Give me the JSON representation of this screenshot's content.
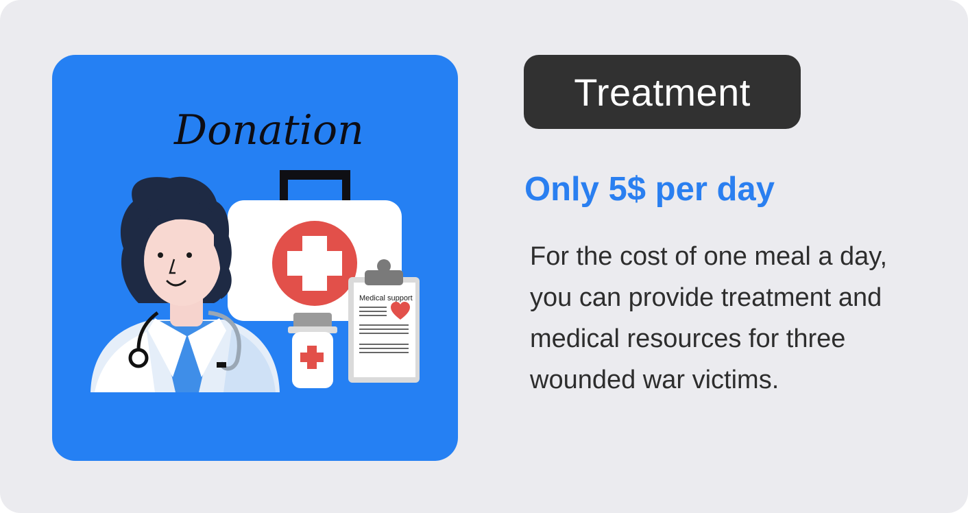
{
  "illustration": {
    "title": "Donation",
    "clipboard_title": "Medical support",
    "icons": [
      "doctor-icon",
      "first-aid-kit-icon",
      "medicine-bottle-icon",
      "clipboard-icon",
      "heart-icon",
      "stethoscope-icon"
    ],
    "background_color": "#2580f3",
    "cross_color": "#e2504a"
  },
  "badge": {
    "label": "Treatment",
    "background_color": "#313131"
  },
  "headline": {
    "text": "Only 5$ per day",
    "color": "#2a7ff0"
  },
  "description": {
    "lines": [
      "For the cost of one meal a day,",
      "you can provide treatment and",
      "medical resources for three",
      "wounded war victims."
    ]
  }
}
